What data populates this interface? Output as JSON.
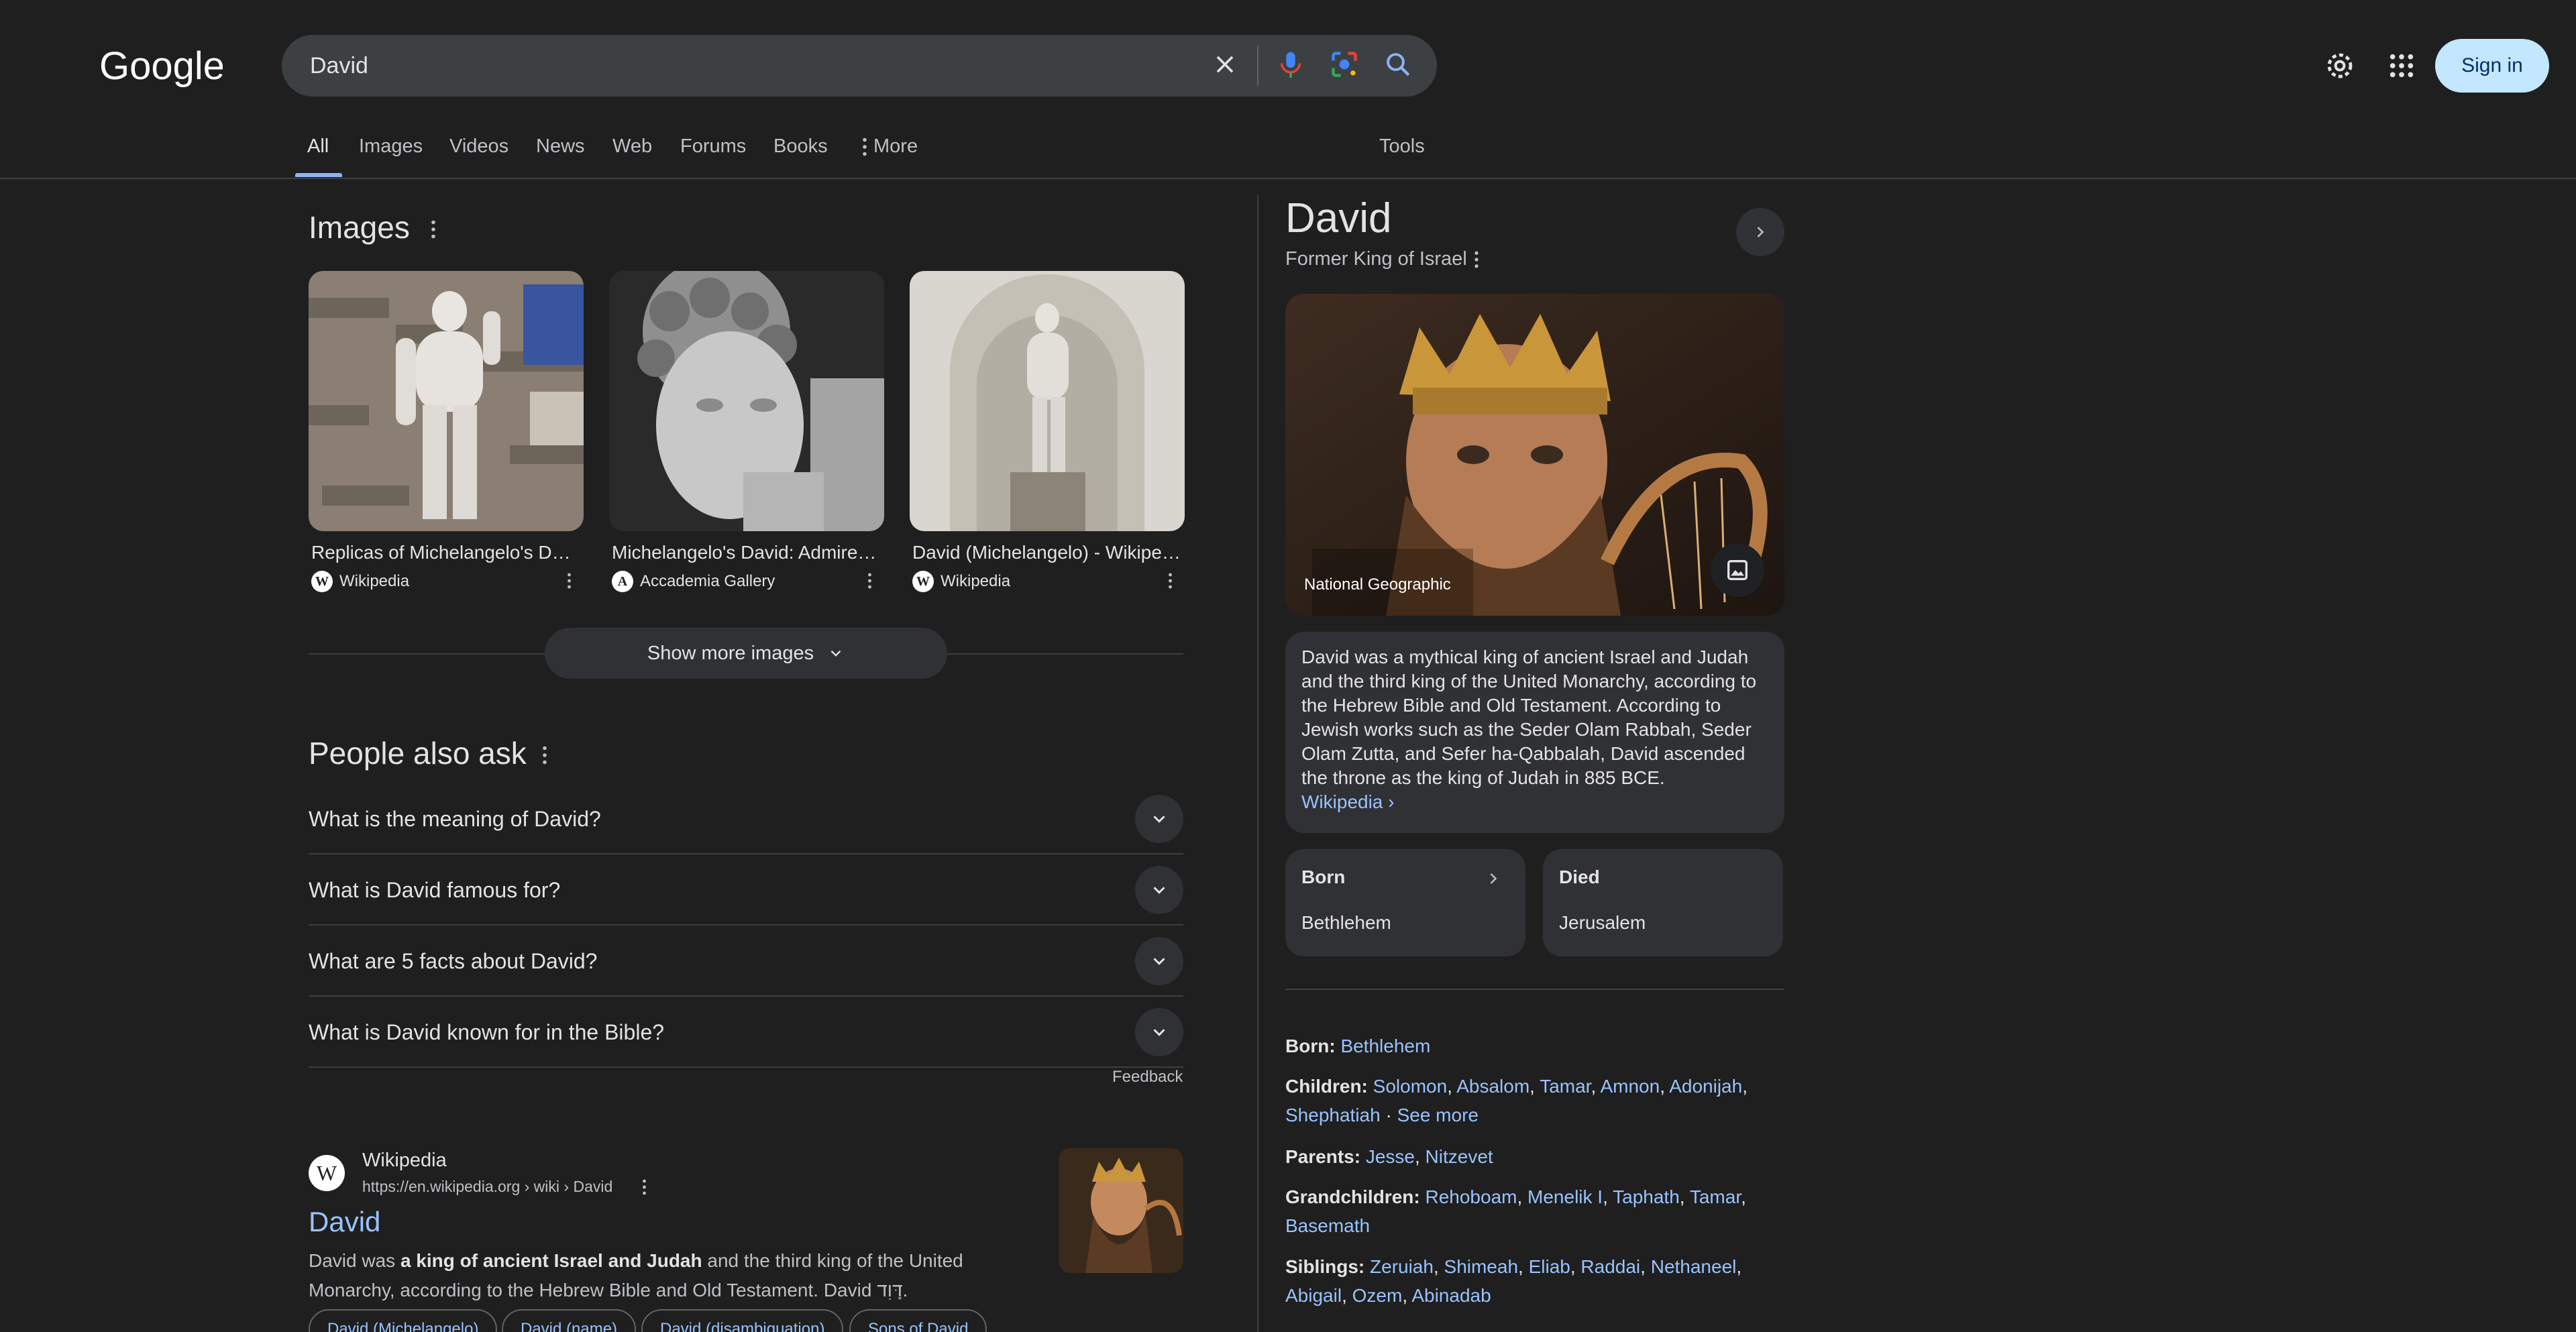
{
  "logo": "Google",
  "search": {
    "value": "David"
  },
  "header": {
    "sign_in": "Sign in"
  },
  "tabs": [
    {
      "label": "All",
      "active": true
    },
    {
      "label": "Images"
    },
    {
      "label": "Videos"
    },
    {
      "label": "News"
    },
    {
      "label": "Web"
    },
    {
      "label": "Forums"
    },
    {
      "label": "Books"
    },
    {
      "label": "More"
    }
  ],
  "tools_label": "Tools",
  "images_section": {
    "title": "Images",
    "items": [
      {
        "caption": "Replicas of Michelangelo's David ...",
        "source": "Wikipedia",
        "logo": "W"
      },
      {
        "caption": "Michelangelo's David: Admired ...",
        "source": "Accademia Gallery",
        "logo": "A"
      },
      {
        "caption": "David (Michelangelo) - Wikipedia",
        "source": "Wikipedia",
        "logo": "W"
      }
    ],
    "show_more": "Show more images"
  },
  "paa": {
    "title": "People also ask",
    "questions": [
      "What is the meaning of David?",
      "What is David famous for?",
      "What are 5 facts about David?",
      "What is David known for in the Bible?"
    ],
    "feedback": "Feedback"
  },
  "result": {
    "site_name": "Wikipedia",
    "url": "https://en.wikipedia.org › wiki › David",
    "title": "David",
    "snippet_pre": "David was ",
    "snippet_bold": "a king of ancient Israel and Judah",
    "snippet_post": " and the third king of the United Monarchy, according to the Hebrew Bible and Old Testament. David דָּוִד.",
    "chips": [
      "David (Michelangelo)",
      "David (name)",
      "David (disambiguation)",
      "Sons of David"
    ]
  },
  "knowledge_panel": {
    "title": "David",
    "subtitle": "Former King of Israel",
    "image_credit": "National Geographic",
    "description": "David was a mythical king of ancient Israel and Judah and the third king of the United Monarchy, according to the Hebrew Bible and Old Testament. According to Jewish works such as the Seder Olam Rabbah, Seder Olam Zutta, and Sefer ha-Qabbalah, David ascended the throne as the king of Judah in 885 BCE.",
    "desc_link": "Wikipedia ›",
    "born_label": "Born",
    "born_value": "Bethlehem",
    "died_label": "Died",
    "died_value": "Jerusalem",
    "facts": {
      "born": {
        "label": "Born:",
        "values": [
          "Bethlehem"
        ]
      },
      "children": {
        "label": "Children:",
        "values": [
          "Solomon",
          "Absalom",
          "Tamar",
          "Amnon",
          "Adonijah",
          "Shephatiah"
        ],
        "more": "See more"
      },
      "parents": {
        "label": "Parents:",
        "values": [
          "Jesse",
          "Nitzevet"
        ]
      },
      "grandchildren": {
        "label": "Grandchildren:",
        "values": [
          "Rehoboam",
          "Menelik I",
          "Taphath",
          "Tamar",
          "Basemath"
        ]
      },
      "siblings": {
        "label": "Siblings:",
        "values": [
          "Zeruiah",
          "Shimeah",
          "Eliab",
          "Raddai",
          "Nethaneel",
          "Abigail",
          "Ozem",
          "Abinadab"
        ]
      }
    }
  }
}
